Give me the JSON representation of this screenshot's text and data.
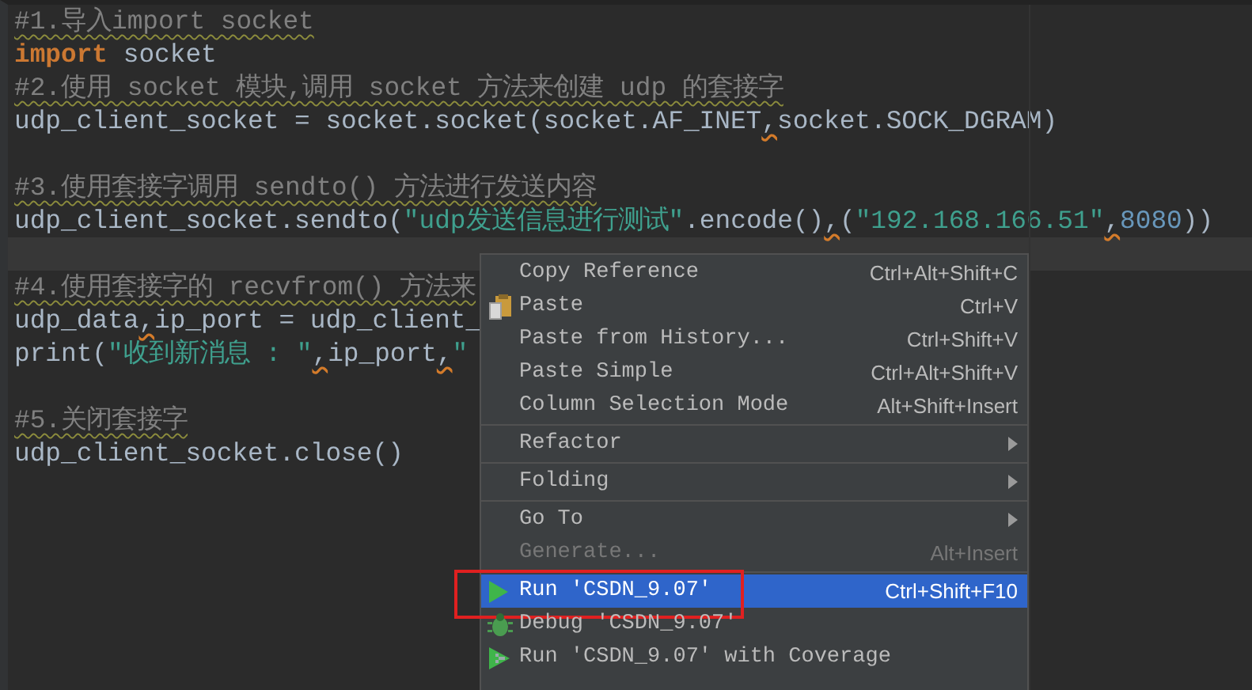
{
  "editor": {
    "lines": [
      {
        "current": false,
        "segments": [
          {
            "kind": "comment",
            "text": "#1.导入import socket"
          }
        ]
      },
      {
        "current": false,
        "segments": [
          {
            "kind": "keyword",
            "text": "import"
          },
          {
            "kind": "plain",
            "text": " socket"
          }
        ]
      },
      {
        "current": false,
        "segments": [
          {
            "kind": "comment",
            "text": "#2.使用 socket 模块,调用 socket 方法来创建 udp 的套接字"
          }
        ]
      },
      {
        "current": false,
        "segments": [
          {
            "kind": "plain",
            "text": "udp_client_socket = socket.socket(socket.AF_INET"
          },
          {
            "kind": "warn",
            "text": ","
          },
          {
            "kind": "plain",
            "text": "socket.SOCK_DGRAM)"
          }
        ]
      },
      {
        "current": false
      },
      {
        "current": false,
        "segments": [
          {
            "kind": "comment",
            "text": "#3.使用套接字调用 sendto() 方法进行发送内容"
          }
        ]
      },
      {
        "current": false,
        "segments": [
          {
            "kind": "plain",
            "text": "udp_client_socket.sendto("
          },
          {
            "kind": "string",
            "text": "\"udp发送信息进行测试\""
          },
          {
            "kind": "plain",
            "text": ".encode()"
          },
          {
            "kind": "warn",
            "text": ","
          },
          {
            "kind": "plain",
            "text": "("
          },
          {
            "kind": "string",
            "text": "\"192.168.166.51\""
          },
          {
            "kind": "warn",
            "text": ","
          },
          {
            "kind": "number",
            "text": "8080"
          },
          {
            "kind": "plain",
            "text": "))"
          }
        ]
      },
      {
        "current": true
      },
      {
        "current": false,
        "segments": [
          {
            "kind": "comment",
            "text": "#4.使用套接字的 recvfrom() 方法来"
          }
        ]
      },
      {
        "current": false,
        "segments": [
          {
            "kind": "plain",
            "text": "udp_data"
          },
          {
            "kind": "warn",
            "text": ","
          },
          {
            "kind": "plain",
            "text": "ip_port = udp_client_"
          }
        ]
      },
      {
        "current": false,
        "segments": [
          {
            "kind": "plain",
            "text": "print("
          },
          {
            "kind": "string",
            "text": "\"收到新消息 : \""
          },
          {
            "kind": "warn",
            "text": ","
          },
          {
            "kind": "plain",
            "text": "ip_port"
          },
          {
            "kind": "warn",
            "text": ","
          },
          {
            "kind": "string",
            "text": "\""
          }
        ]
      },
      {
        "current": false
      },
      {
        "current": false,
        "segments": [
          {
            "kind": "comment",
            "text": "#5.关闭套接字"
          }
        ]
      },
      {
        "current": false,
        "segments": [
          {
            "kind": "plain",
            "text": "udp_client_socket.close()"
          }
        ]
      }
    ]
  },
  "context_menu": {
    "items": [
      {
        "kind": "plain",
        "label": "Copy Reference",
        "shortcut": "Ctrl+Alt+Shift+C",
        "submenu": false,
        "disabled": false,
        "selected": false,
        "marked": false
      },
      {
        "kind": "paste",
        "label": "Paste",
        "shortcut": "Ctrl+V",
        "submenu": false,
        "disabled": false,
        "selected": false,
        "marked": false
      },
      {
        "kind": "plain",
        "label": "Paste from History...",
        "shortcut": "Ctrl+Shift+V",
        "submenu": false,
        "disabled": false,
        "selected": false,
        "marked": false
      },
      {
        "kind": "plain",
        "label": "Paste Simple",
        "shortcut": "Ctrl+Alt+Shift+V",
        "submenu": false,
        "disabled": false,
        "selected": false,
        "marked": false
      },
      {
        "kind": "plain",
        "label": "Column Selection Mode",
        "shortcut": "Alt+Shift+Insert",
        "submenu": false,
        "disabled": false,
        "selected": false,
        "marked": false
      },
      {
        "kind": "separator"
      },
      {
        "kind": "plain",
        "label": "Refactor",
        "submenu": true,
        "disabled": false,
        "selected": false,
        "marked": false
      },
      {
        "kind": "separator"
      },
      {
        "kind": "plain",
        "label": "Folding",
        "submenu": true,
        "disabled": false,
        "selected": false,
        "marked": false
      },
      {
        "kind": "separator"
      },
      {
        "kind": "plain",
        "label": "Go To",
        "submenu": true,
        "disabled": false,
        "selected": false,
        "marked": false
      },
      {
        "kind": "plain",
        "label": "Generate...",
        "shortcut": "Alt+Insert",
        "submenu": false,
        "disabled": true,
        "selected": false,
        "marked": false
      },
      {
        "kind": "separator"
      },
      {
        "kind": "run",
        "label": "Run 'CSDN_9.07'",
        "shortcut": "Ctrl+Shift+F10",
        "submenu": false,
        "disabled": false,
        "selected": true,
        "marked": true
      },
      {
        "kind": "debug",
        "label": "Debug 'CSDN_9.07'",
        "submenu": false,
        "disabled": false,
        "selected": false,
        "marked": false
      },
      {
        "kind": "coverage",
        "label": "Run 'CSDN_9.07' with Coverage",
        "submenu": false,
        "disabled": false,
        "selected": false,
        "marked": false
      }
    ]
  }
}
